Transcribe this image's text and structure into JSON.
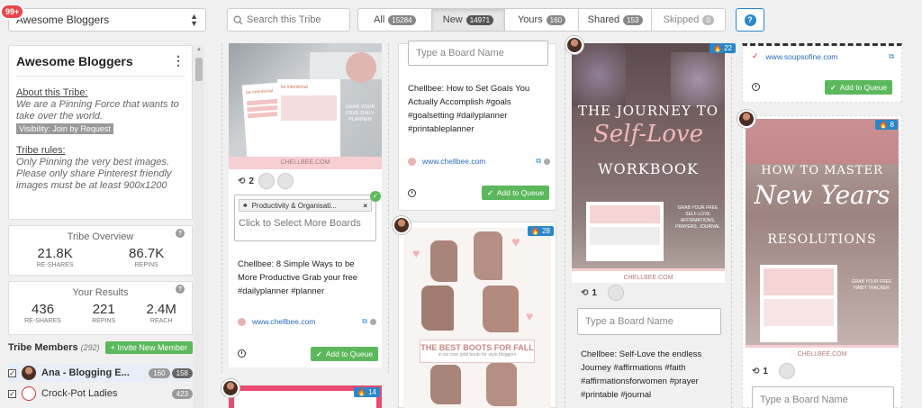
{
  "notifications": "99+",
  "tribe_select": {
    "value": "Awesome Bloggers"
  },
  "about": {
    "title": "Awesome Bloggers",
    "about_heading": "About this Tribe:",
    "about_text": "We are a Pinning Force that wants to take over the world.",
    "visibility": "Visibility: Join by Request",
    "rules_heading": "Tribe rules:",
    "rules_text": "Only Pinning the very best images. Please only share Pinterest friendly images must be at least 900x1200"
  },
  "overview": {
    "title": "Tribe Overview",
    "reshares": "21.8K",
    "reshares_label": "RE-SHARES",
    "repins": "86.7K",
    "repins_label": "REPINS"
  },
  "results": {
    "title": "Your Results",
    "reshares": "436",
    "reshares_label": "RE-SHARES",
    "repins": "221",
    "repins_label": "REPINS",
    "reach": "2.4M",
    "reach_label": "REACH"
  },
  "members": {
    "title": "Tribe Members",
    "count": "(292)",
    "invite_label": "Invite New Member",
    "list": [
      {
        "name": "Ana - Blogging E...",
        "count1": "160",
        "count2": "158"
      },
      {
        "name": "Crock-Pot Ladies",
        "count1": "423"
      }
    ]
  },
  "search": {
    "placeholder": "Search this Tribe"
  },
  "tabs": [
    {
      "label": "All",
      "count": "15284"
    },
    {
      "label": "New",
      "count": "14971"
    },
    {
      "label": "Yours",
      "count": "160"
    },
    {
      "label": "Shared",
      "count": "153"
    },
    {
      "label": "Skipped",
      "count": "0"
    }
  ],
  "help_label": "?",
  "pins": {
    "p1": {
      "image_brand": "CHELLBEE.COM",
      "image_text": "GRAB YOUR FREE DAILY PLANNER",
      "image_header": "be intentional",
      "repins": "2",
      "board_tag": "Productivity & Organisati...",
      "board_placeholder": "Click to Select More Boards",
      "description": "Chellbee: 8 Simple Ways to be More Productive Grab your free #dailyplanner #planner",
      "source": "www.chellbee.com",
      "queue_label": "Add to Queue"
    },
    "p2": {
      "board_placeholder": "Type a Board Name",
      "description": "Chellbee: How to Set Goals You Actually Accomplish #goals #goalsetting #dailyplanner #printableplanner",
      "source": "www.chellbee.com",
      "queue_label": "Add to Queue"
    },
    "p3": {
      "badge": "28",
      "image_title": "THE BEST BOOTS FOR FALL",
      "image_sub": "in six rose gold boots for style bloggers"
    },
    "p4": {
      "badge": "22",
      "image_title_1": "THE JOURNEY TO",
      "image_title_2": "Self-Love",
      "image_title_3": "WORKBOOK",
      "image_side": "GRAB YOUR FREE SELF-LOVE AFFIRMATIONS, PRAYERS, JOURNAL",
      "image_brand": "CHELLBEE.COM",
      "repins": "1",
      "board_placeholder": "Type a Board Name",
      "description": "Chellbee: Self-Love the endless Journey #affirmations #faith #affirmationsforwomen #prayer #printable #journal"
    },
    "p5": {
      "source": "www.soupsofine.com",
      "queue_label": "Add to Queue"
    },
    "p6": {
      "badge": "8",
      "image_title_1": "HOW TO MASTER",
      "image_title_2": "New Years",
      "image_title_3": "RESOLUTIONS",
      "image_side": "GRAB YOUR FREE HABIT TRACKER",
      "image_brand": "CHELLBEE.COM",
      "repins": "1",
      "board_placeholder": "Type a Board Name"
    },
    "p7": {
      "badge": "14"
    }
  }
}
